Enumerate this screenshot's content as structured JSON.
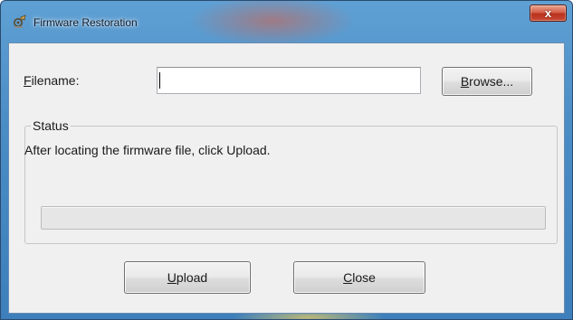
{
  "window": {
    "title": "Firmware Restoration",
    "close_glyph": "x",
    "app_icon": "firmware-restoration-icon"
  },
  "filename": {
    "label_accel": "F",
    "label_rest": "ilename:",
    "value": "",
    "placeholder": ""
  },
  "browse": {
    "label_accel": "B",
    "label_rest": "rowse..."
  },
  "status": {
    "group_label": "Status",
    "message": "After locating the firmware file, click Upload.",
    "progress": 0
  },
  "actions": {
    "upload_accel": "U",
    "upload_rest": "pload",
    "close_accel": "C",
    "close_rest": "lose"
  },
  "colors": {
    "title_bar": "#4a8cc4",
    "close_button": "#c94a33",
    "dialog_bg": "#f0f0f0"
  }
}
